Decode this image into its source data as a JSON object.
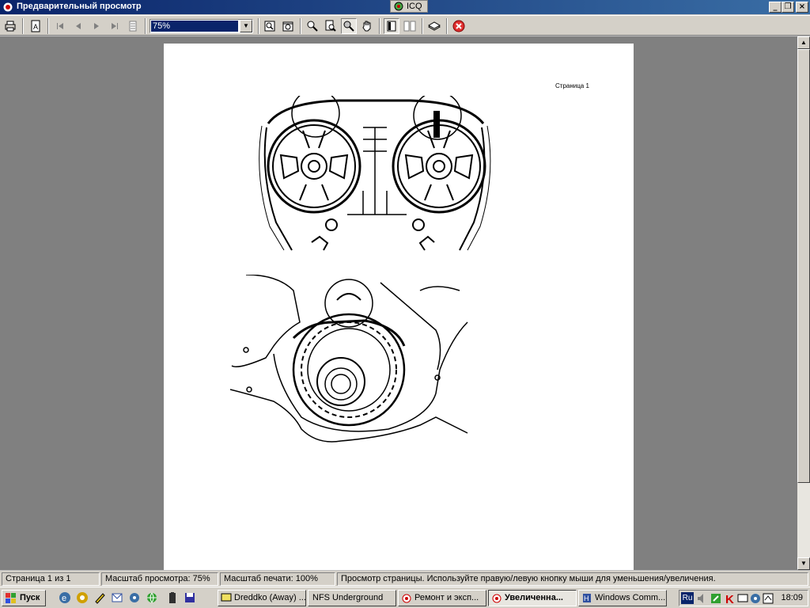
{
  "window": {
    "title": "Предварительный просмотр",
    "icq_label": "ICQ"
  },
  "toolbar": {
    "zoom_value": "75%",
    "buttons": [
      "print-icon",
      "page-setup-icon",
      "first-page-icon",
      "prev-page-icon",
      "next-page-icon",
      "last-page-icon",
      "page-icon",
      "zoom-fit-icon",
      "zoom-width-icon",
      "zoom-in-icon",
      "zoom-out-icon",
      "magnifier-icon",
      "hand-icon",
      "one-page-icon",
      "two-pages-icon",
      "layers-icon",
      "close-icon"
    ]
  },
  "page": {
    "page_label": "Страница 1"
  },
  "statusbar": {
    "page_info": "Страница 1 из 1",
    "view_scale": "Масштаб просмотра: 75%",
    "print_scale": "Масштаб печати: 100%",
    "hint": "Просмотр страницы. Используйте правую/левую кнопку мыши для уменьшения/увеличения."
  },
  "taskbar": {
    "start_label": "Пуск",
    "tasks": [
      {
        "label": "Dreddko (Away) ...",
        "active": false
      },
      {
        "label": "NFS Underground",
        "active": false
      },
      {
        "label": "Ремонт и эксп...",
        "active": false
      },
      {
        "label": "Увеличенна...",
        "active": true
      },
      {
        "label": "Windows Comm...",
        "active": false
      }
    ],
    "tray": {
      "lang": "Ru",
      "clock": "18:09"
    }
  },
  "colors": {
    "titlebar_start": "#0a246a",
    "titlebar_end": "#3a6ea5",
    "preview_bg": "#808080",
    "face": "#d4d0c8"
  }
}
